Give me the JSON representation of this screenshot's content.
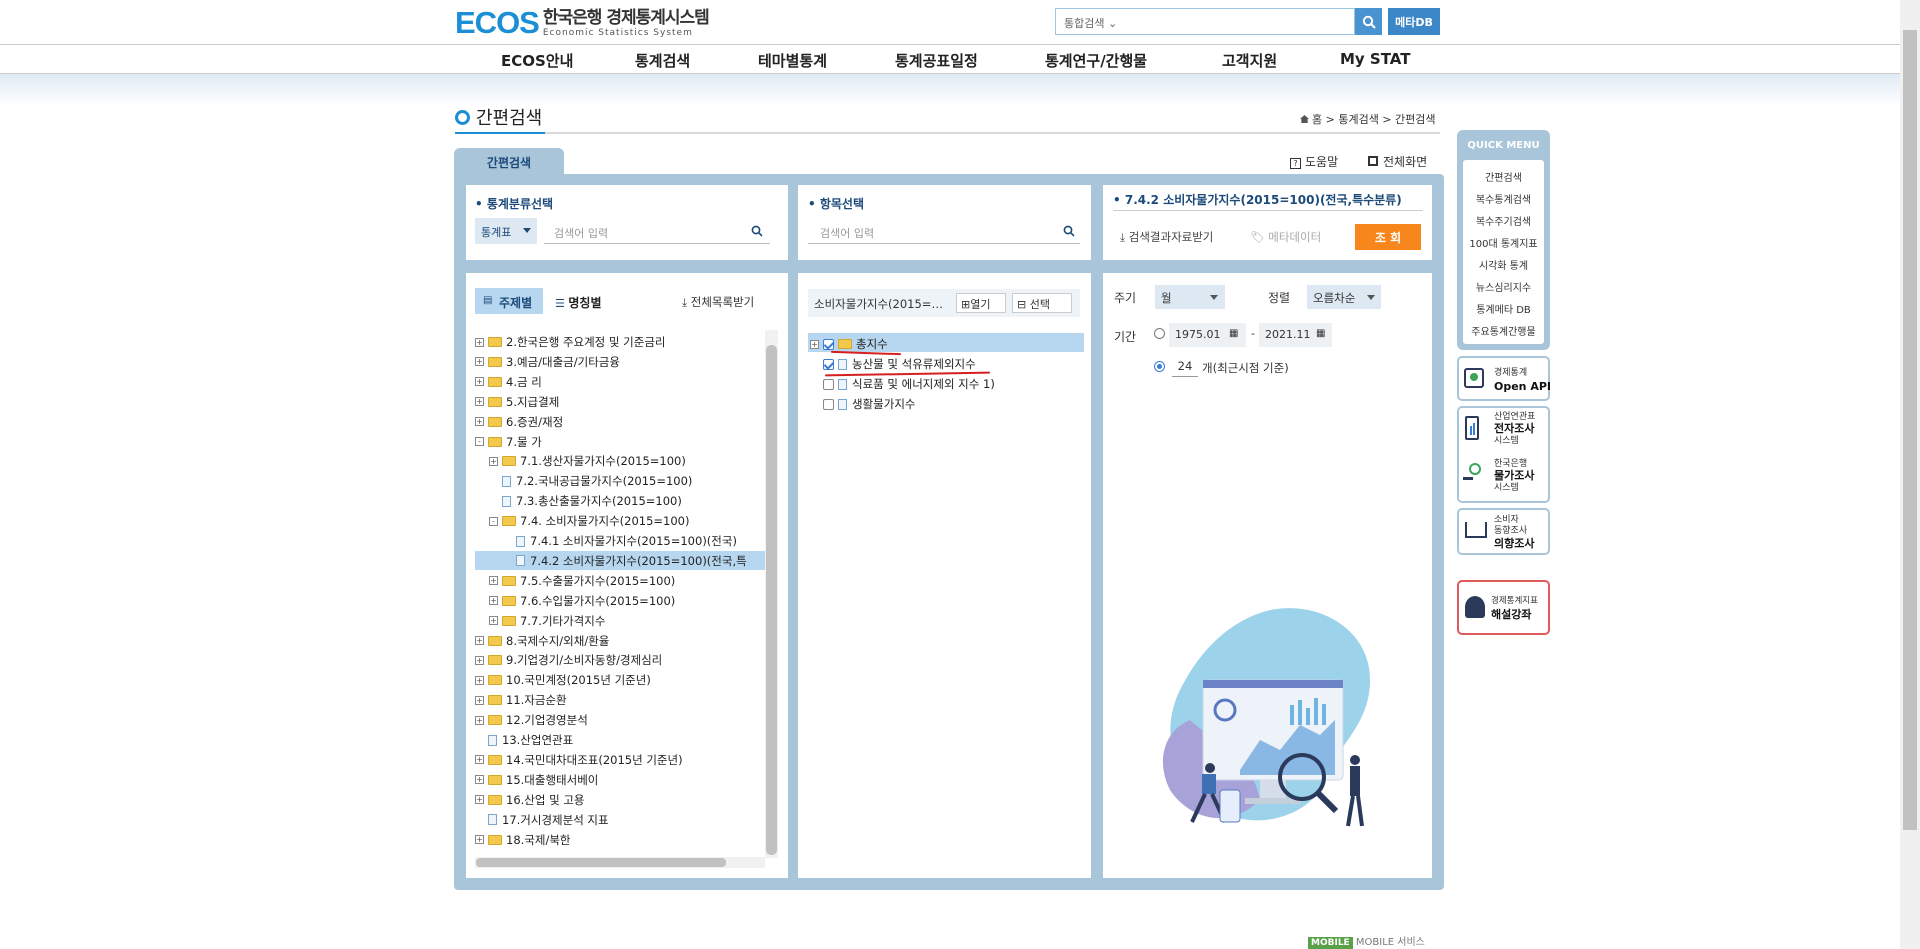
{
  "header": {
    "logo_mark": "ECOS",
    "logo_kr": "한국은행 경제통계시스템",
    "logo_en": "Economic Statistics System",
    "search_select": "통합검색",
    "metadb": "메타DB"
  },
  "gnb": [
    "ECOS안내",
    "통계검색",
    "테마별통계",
    "통계공표일정",
    "통계연구/간행물",
    "고객지원",
    "My STAT"
  ],
  "page": {
    "title": "간편검색",
    "breadcrumb": "홈 > 통계검색 > 간편검색",
    "tab": "간편검색",
    "help": "도움말",
    "fullscreen": "전체화면"
  },
  "category_box": {
    "title": "• 통계분류선택",
    "select": "통계표",
    "placeholder": "검색어 입력"
  },
  "item_box": {
    "title": "• 항목선택",
    "placeholder": "검색어 입력"
  },
  "result_box": {
    "title": "• 7.4.2 소비자물가지수(2015=100)(전국,특수분류)",
    "download": "검색결과자료받기",
    "metadata": "메타데이터",
    "query": "조 회"
  },
  "tree_panel": {
    "tab_subject": "주제별",
    "tab_name": "명칭별",
    "download_all": "전체목록받기",
    "nodes": [
      {
        "label": "2.한국은행 주요계정 및 기준금리",
        "level": 0,
        "type": "folder",
        "exp": "+"
      },
      {
        "label": "3.예금/대출금/기타금융",
        "level": 0,
        "type": "folder",
        "exp": "+"
      },
      {
        "label": "4.금 리",
        "level": 0,
        "type": "folder",
        "exp": "+"
      },
      {
        "label": "5.지급결제",
        "level": 0,
        "type": "folder",
        "exp": "+"
      },
      {
        "label": "6.증권/재정",
        "level": 0,
        "type": "folder",
        "exp": "+"
      },
      {
        "label": "7.물 가",
        "level": 0,
        "type": "folder",
        "exp": "-"
      },
      {
        "label": "7.1.생산자물가지수(2015=100)",
        "level": 1,
        "type": "folder",
        "exp": "+"
      },
      {
        "label": "7.2.국내공급물가지수(2015=100)",
        "level": 1,
        "type": "doc",
        "exp": ""
      },
      {
        "label": "7.3.총산출물가지수(2015=100)",
        "level": 1,
        "type": "doc",
        "exp": ""
      },
      {
        "label": "7.4. 소비자물가지수(2015=100)",
        "level": 1,
        "type": "folder",
        "exp": "-"
      },
      {
        "label": "7.4.1 소비자물가지수(2015=100)(전국)",
        "level": 2,
        "type": "doc",
        "exp": ""
      },
      {
        "label": "7.4.2 소비자물가지수(2015=100)(전국,특",
        "level": 2,
        "type": "doc",
        "exp": "",
        "selected": true
      },
      {
        "label": "7.5.수출물가지수(2015=100)",
        "level": 1,
        "type": "folder",
        "exp": "+"
      },
      {
        "label": "7.6.수입물가지수(2015=100)",
        "level": 1,
        "type": "folder",
        "exp": "+"
      },
      {
        "label": "7.7.기타가격지수",
        "level": 1,
        "type": "folder",
        "exp": "+"
      },
      {
        "label": "8.국제수지/외채/환율",
        "level": 0,
        "type": "folder",
        "exp": "+"
      },
      {
        "label": "9.기업경기/소비자동향/경제심리",
        "level": 0,
        "type": "folder",
        "exp": "+"
      },
      {
        "label": "10.국민계정(2015년 기준년)",
        "level": 0,
        "type": "folder",
        "exp": "+"
      },
      {
        "label": "11.자금순환",
        "level": 0,
        "type": "folder",
        "exp": "+"
      },
      {
        "label": "12.기업경영분석",
        "level": 0,
        "type": "folder",
        "exp": "+"
      },
      {
        "label": "13.산업연관표",
        "level": 0,
        "type": "doc",
        "exp": ""
      },
      {
        "label": "14.국민대차대조표(2015년 기준년)",
        "level": 0,
        "type": "folder",
        "exp": "+"
      },
      {
        "label": "15.대출행태서베이",
        "level": 0,
        "type": "folder",
        "exp": "+"
      },
      {
        "label": "16.산업 및 고용",
        "level": 0,
        "type": "folder",
        "exp": "+"
      },
      {
        "label": "17.거시경제분석 지표",
        "level": 0,
        "type": "doc",
        "exp": ""
      },
      {
        "label": "18.국제/북한",
        "level": 0,
        "type": "folder",
        "exp": "+"
      }
    ]
  },
  "items_panel": {
    "header": "소비자물가지수(2015=…",
    "open": "열기",
    "select": "선택",
    "items": [
      {
        "label": "총지수",
        "checked": true,
        "type": "folder",
        "selected": true
      },
      {
        "label": "농산물 및 석유류제외지수",
        "checked": true,
        "type": "doc"
      },
      {
        "label": "식료품 및 에너지제외 지수 1)",
        "checked": false,
        "type": "doc"
      },
      {
        "label": "생활물가지수",
        "checked": false,
        "type": "doc"
      }
    ]
  },
  "options_panel": {
    "cycle_label": "주기",
    "cycle_value": "월",
    "sort_label": "정렬",
    "sort_value": "오름차순",
    "period_label": "기간",
    "from": "1975.01",
    "to": "2021.11",
    "dash": "-",
    "recent_count": "24",
    "recent_suffix": "개(최근시점 기준)"
  },
  "quick_menu": {
    "title": "QUICK MENU",
    "items": [
      "간편검색",
      "복수통계검색",
      "복수주기검색",
      "100대 통계지표",
      "시각화 통계",
      "뉴스심리지수",
      "통계메타 DB",
      "주요통계간행물"
    ]
  },
  "side_cards": {
    "openapi_small": "경제통계",
    "openapi_big": "Open API",
    "survey1_a": "산업연관표",
    "survey1_b": "전자조사",
    "survey1_c": "시스템",
    "survey2_a": "한국은행",
    "survey2_b": "물가조사",
    "survey2_c": "시스템",
    "survey3_a": "소비자",
    "survey3_b": "동향조사",
    "survey3_c": "의향조사",
    "lecture_small": "경제통계지표",
    "lecture_big": "해설강좌"
  },
  "footer": {
    "mobile_badge": "MOBILE",
    "mobile_text": "MOBILE 서비스"
  },
  "colors": {
    "accent": "#1a8fd6",
    "panel": "#a9c5d9",
    "orange": "#f7861c",
    "select_row": "#b7d6ef"
  }
}
